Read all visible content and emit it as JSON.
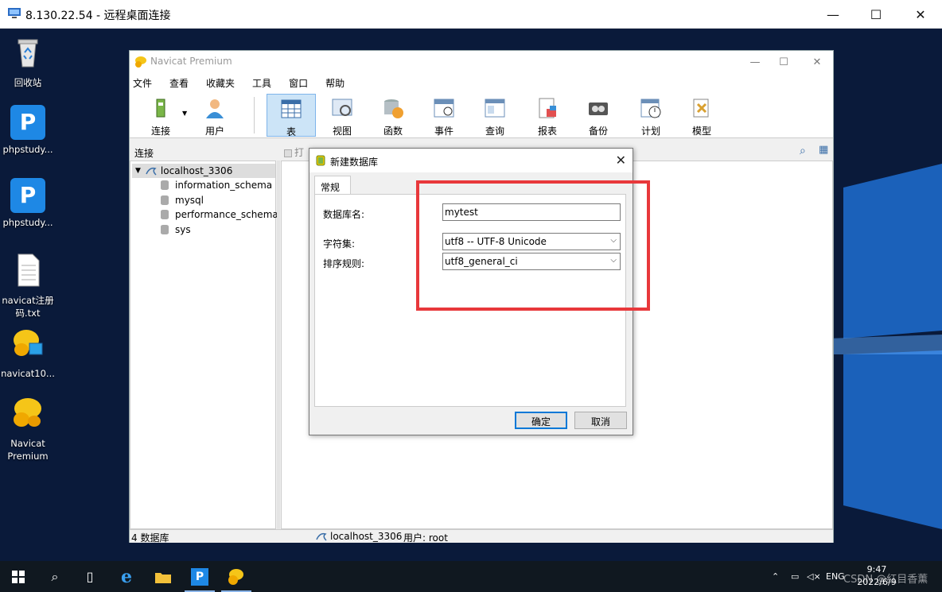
{
  "rdp": {
    "title": "8.130.22.54 - 远程桌面连接",
    "minimize": "—",
    "maximize": "☐",
    "close": "✕"
  },
  "desktop_icons": [
    {
      "label": "回收站",
      "icon": "recycle-bin-icon"
    },
    {
      "label": "phpstudy...",
      "icon": "phpstudy-icon"
    },
    {
      "label": "phpstudy...",
      "icon": "phpstudy-icon"
    },
    {
      "label": "navicat注册码.txt",
      "icon": "text-file-icon"
    },
    {
      "label": "navicat10...",
      "icon": "navicat-installer-icon"
    },
    {
      "label": "Navicat Premium",
      "icon": "navicat-icon"
    }
  ],
  "navicat": {
    "title": "Navicat Premium",
    "menu": [
      "文件",
      "查看",
      "收藏夹",
      "工具",
      "窗口",
      "帮助"
    ],
    "toolbar": [
      {
        "label": "连接",
        "icon": "connection-icon"
      },
      {
        "label": "用户",
        "icon": "user-icon"
      },
      {
        "label": "表",
        "icon": "table-icon",
        "active": true
      },
      {
        "label": "视图",
        "icon": "view-icon"
      },
      {
        "label": "函数",
        "icon": "function-icon"
      },
      {
        "label": "事件",
        "icon": "event-icon"
      },
      {
        "label": "查询",
        "icon": "query-icon"
      },
      {
        "label": "报表",
        "icon": "report-icon"
      },
      {
        "label": "备份",
        "icon": "backup-icon"
      },
      {
        "label": "计划",
        "icon": "schedule-icon"
      },
      {
        "label": "模型",
        "icon": "model-icon"
      }
    ],
    "left_header": "连接",
    "tree": {
      "connection": "localhost_3306",
      "databases": [
        "information_schema",
        "mysql",
        "performance_schema",
        "sys"
      ]
    },
    "obj_toolbar_partial": "打",
    "status": {
      "db_count": "4 数据库",
      "connection": "localhost_3306",
      "user": "用户: root"
    }
  },
  "dialog": {
    "title": "新建数据库",
    "tab": "常规",
    "db_name_label": "数据库名:",
    "db_name_value": "mytest",
    "charset_label": "字符集:",
    "charset_value": "utf8 -- UTF-8 Unicode",
    "collation_label": "排序规则:",
    "collation_value": "utf8_general_ci",
    "ok": "确定",
    "cancel": "取消"
  },
  "taskbar": {
    "lang": "ENG",
    "time": "9:47",
    "date": "2022/6/9",
    "watermark": "CSDN @红目香薰"
  },
  "colors": {
    "highlight": "#e8383b",
    "active_tab": "#cce4f7",
    "desktop": "#0a1a3a"
  }
}
